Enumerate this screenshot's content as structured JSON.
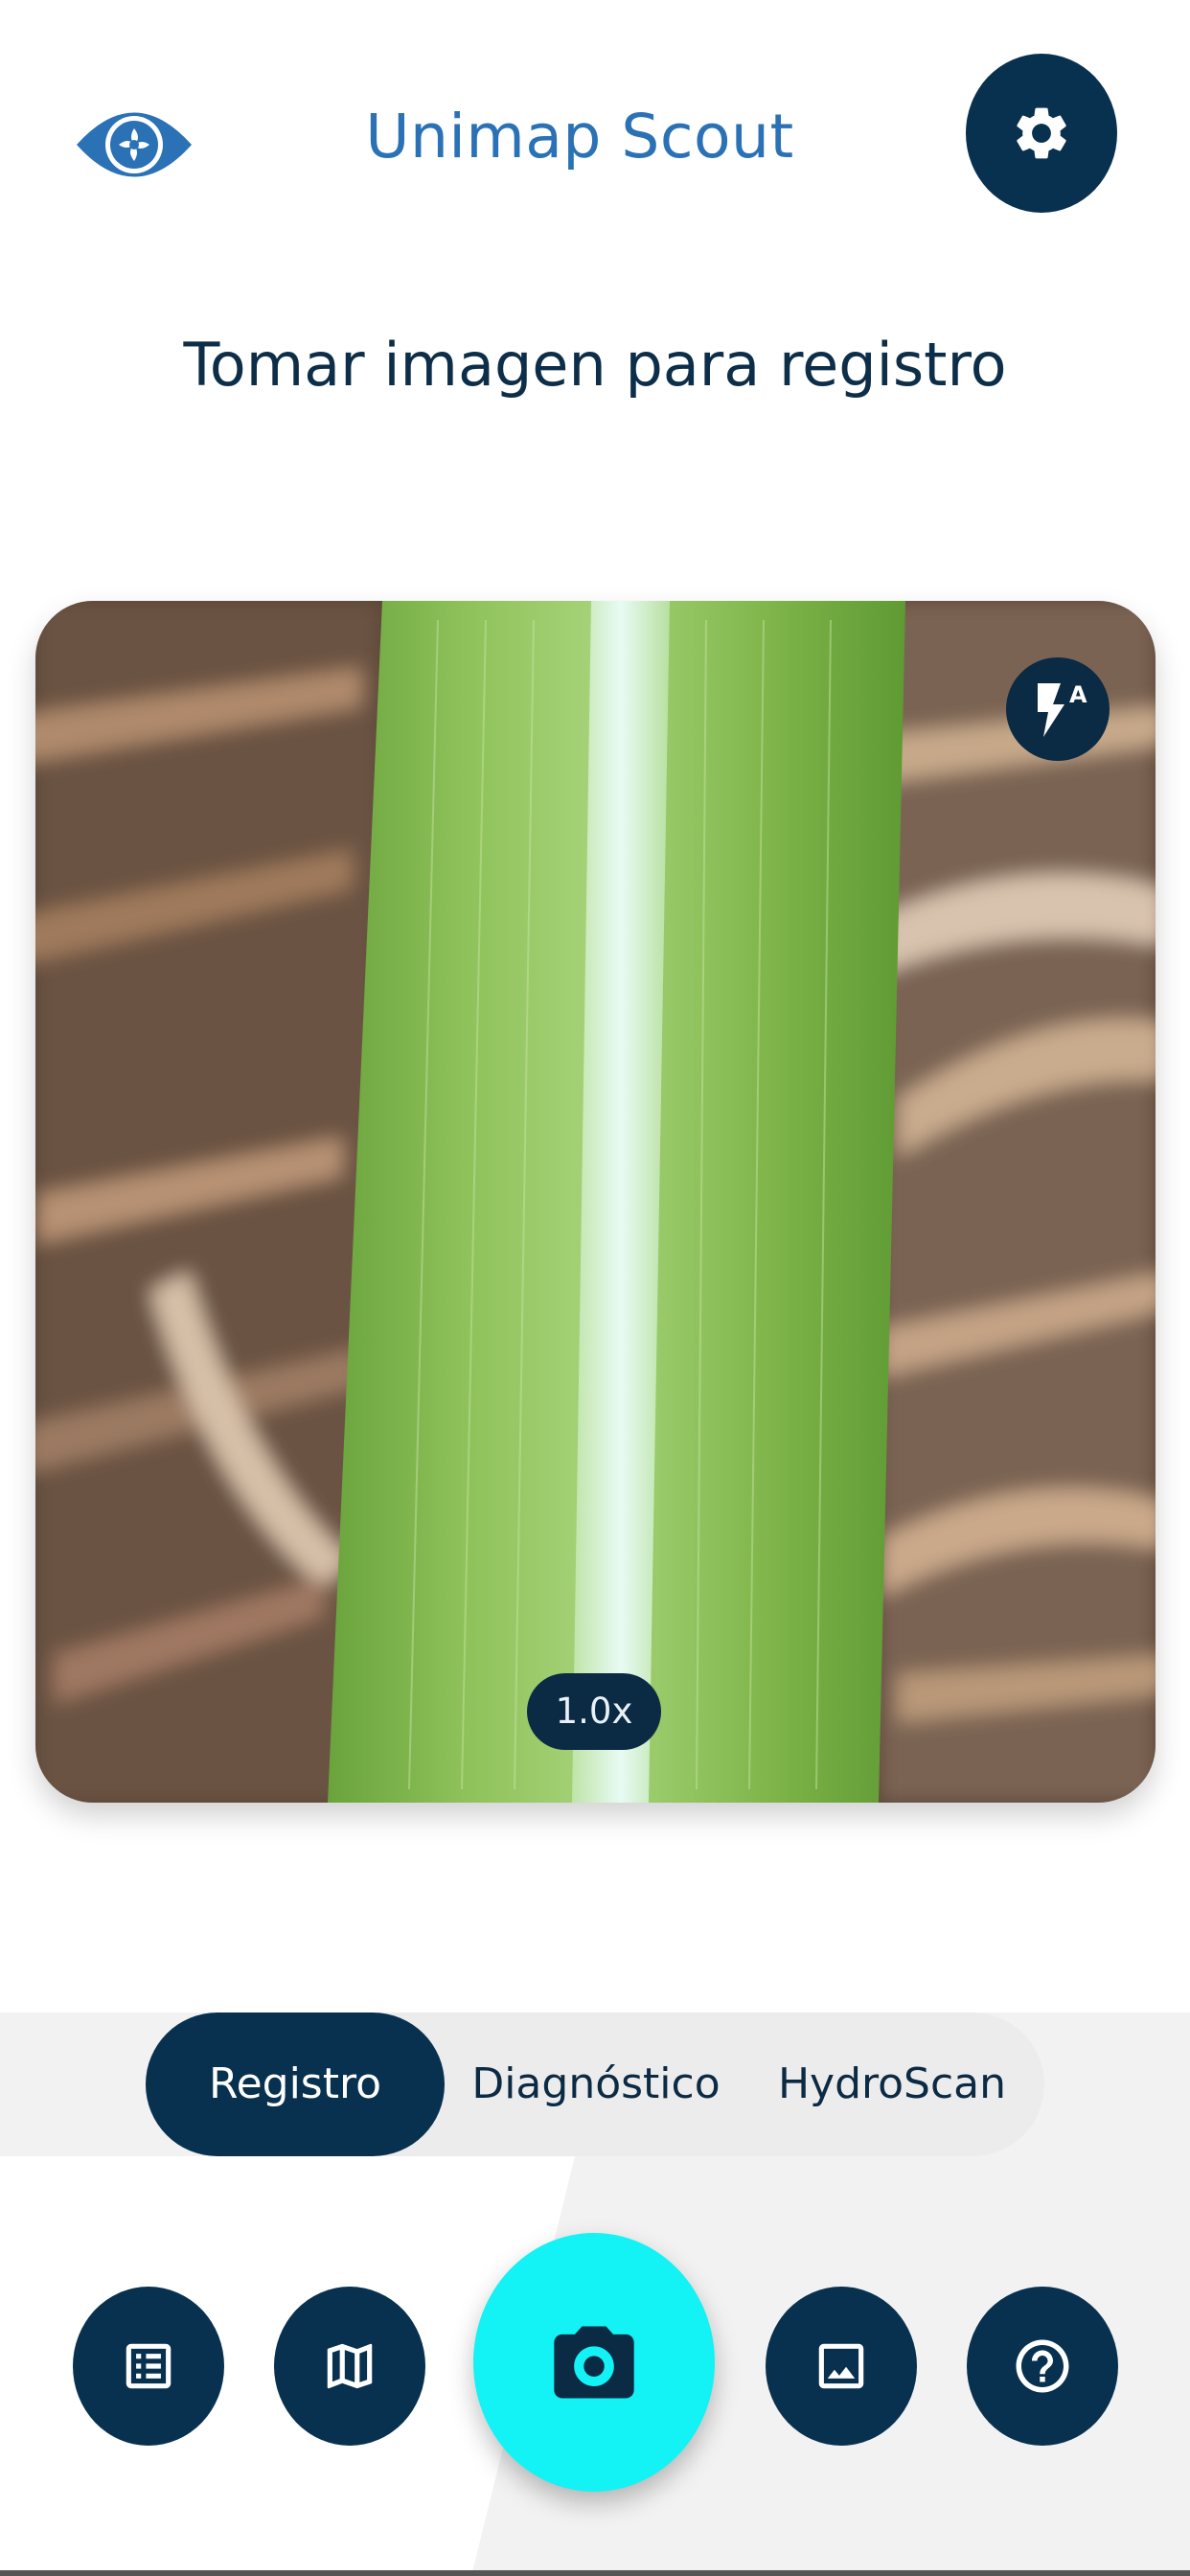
{
  "header": {
    "logo_icon": "eye-logo-icon",
    "title": "Unimap Scout",
    "settings_icon": "gear-icon"
  },
  "page": {
    "title": "Tomar imagen para registro"
  },
  "camera": {
    "flash_icon": "flash-auto-icon",
    "flash_mode_label": "A",
    "zoom_label": "1.0x"
  },
  "modes": {
    "selected": "Registro",
    "tabs": [
      {
        "label": "Registro"
      },
      {
        "label": "Diagnóstico"
      },
      {
        "label": "HydroScan"
      }
    ]
  },
  "bottom_nav": {
    "items": [
      {
        "icon": "list-icon"
      },
      {
        "icon": "map-icon"
      },
      {
        "icon": "camera-icon"
      },
      {
        "icon": "image-icon"
      },
      {
        "icon": "help-icon"
      }
    ]
  },
  "colors": {
    "brand_blue": "#2a72b5",
    "navy": "#08304f",
    "capture_cyan": "#13f2f4"
  }
}
